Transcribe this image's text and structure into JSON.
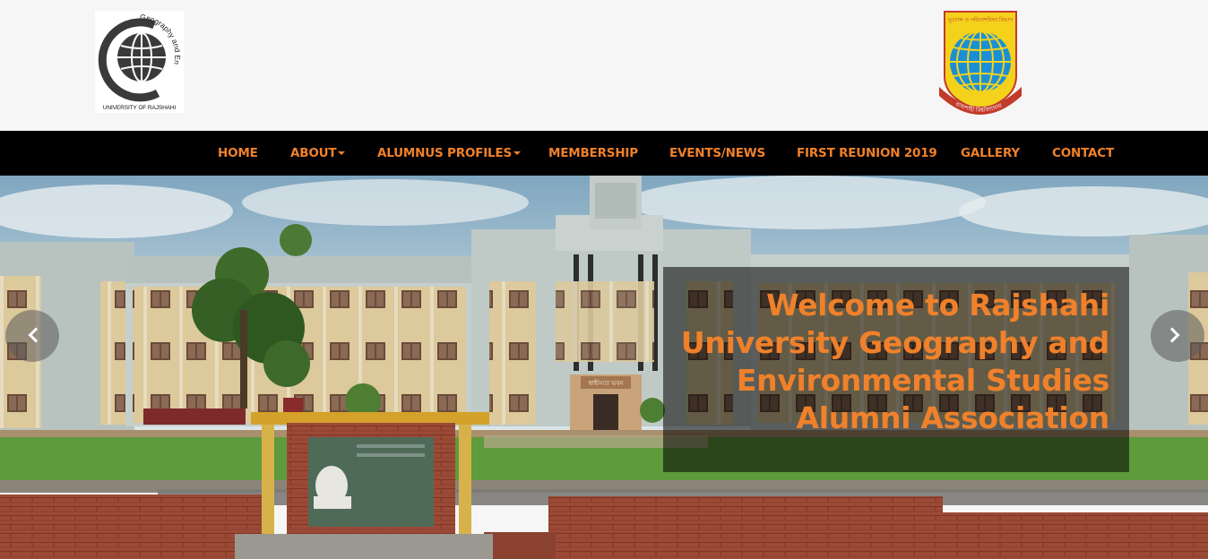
{
  "header": {
    "left_logo": {
      "name": "geography-environmental-studies-logo",
      "arc_text": "Geography and Environmental Studies",
      "bottom_text": "UNIVERSITY OF RAJSHAHI"
    },
    "right_logo": {
      "name": "rajshahi-university-department-emblem",
      "top_text": "ভূগোল ও পরিবেশবিদ্যা বিভাগ",
      "ribbon_text": "রাজশাহী বিশ্ববিদ্যালয়"
    }
  },
  "nav": {
    "items": [
      {
        "label": "HOME",
        "dropdown": false
      },
      {
        "label": "ABOUT",
        "dropdown": true
      },
      {
        "label": "ALUMNUS PROFILES",
        "dropdown": true
      },
      {
        "label": "MEMBERSHIP",
        "dropdown": false
      },
      {
        "label": "EVENTS/NEWS",
        "dropdown": false
      },
      {
        "label": "FIRST REUNION 2019",
        "dropdown": false
      },
      {
        "label": "GALLERY",
        "dropdown": false
      },
      {
        "label": "CONTACT",
        "dropdown": false
      }
    ]
  },
  "hero": {
    "caption_lines": [
      "Welcome to Rajshahi",
      "University Geography and",
      "Environmental Studies",
      "Alumni Association"
    ],
    "building_sign": "স্বাধীনতা ভবন",
    "prev_icon": "chevron-left-icon",
    "next_icon": "chevron-right-icon"
  },
  "colors": {
    "accent": "#f0812a",
    "navbar_bg": "#000000",
    "header_bg": "#f6f6f6"
  }
}
